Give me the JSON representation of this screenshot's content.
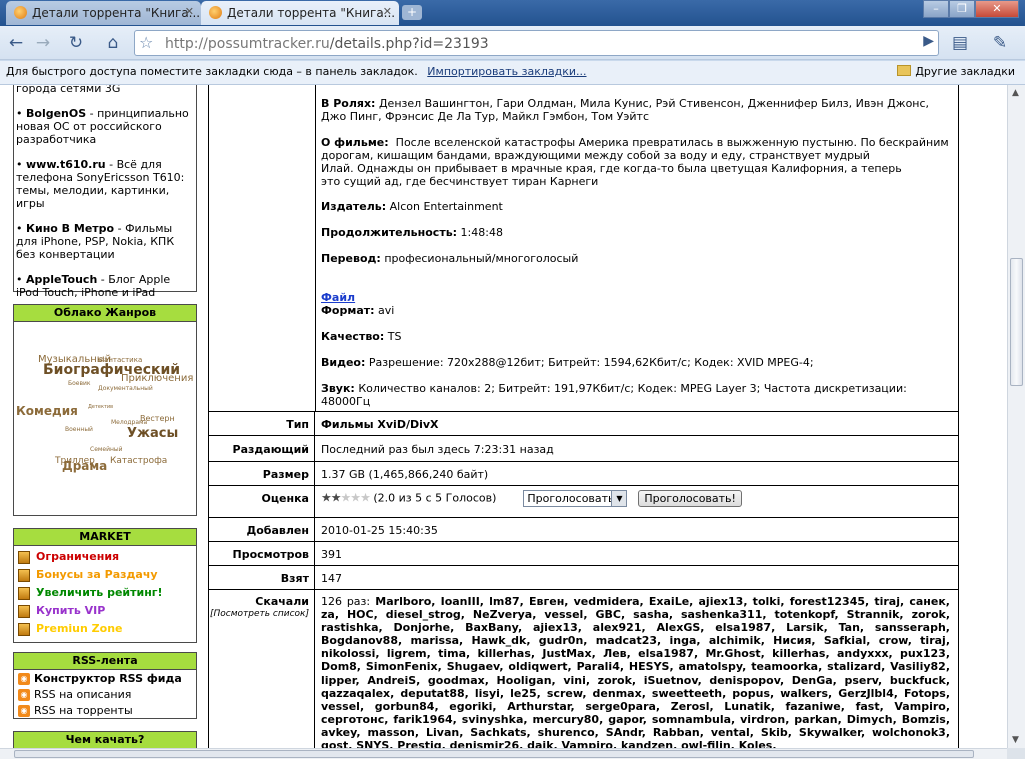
{
  "browser": {
    "tabs": [
      {
        "title": "Детали торрента \"Книга..."
      },
      {
        "title": "Детали торрента \"Книга..."
      }
    ],
    "url_host": "http://possumtracker.ru",
    "url_path": "/details.php?id=23193",
    "bookmarks_hint": "Для быстрого доступа поместите закладки сюда – в панель закладок.",
    "import_link": "Импортировать закладки...",
    "other_bookmarks": "Другие закладки"
  },
  "sidebar": {
    "sites": [
      {
        "pre": "города сетями 3G",
        "name": "",
        "desc": ""
      },
      {
        "name": "BolgenOS",
        "desc": " - принципиально новая ОС от российского разработчика"
      },
      {
        "name": "www.t610.ru",
        "desc": " - Всё для телефона SonyEricsson T610: темы, мелодии, картинки, игры"
      },
      {
        "name": "Кино В Метро",
        "desc": " - Фильмы для iPhone, PSP, Nokia, КПК без конвертации"
      },
      {
        "name": "AppleTouch",
        "desc": " - Блог Apple iPod Touch, iPhone и iPad"
      }
    ],
    "genre_cloud": {
      "title": "Облако Жанров",
      "tags": [
        "Музыкальный",
        "Фантастика",
        "Биографический",
        "Приключения",
        "Боевик",
        "Документальный",
        "Комедия",
        "Детектив",
        "Вестерн",
        "Мелодрама",
        "Военный",
        "Ужасы",
        "Семейный",
        "Триллер",
        "Драма",
        "Катастрофа"
      ]
    },
    "market": {
      "title": "MARKET",
      "items": [
        {
          "label": "Ограничения",
          "color": "#cc0000"
        },
        {
          "label": "Бонусы за Раздачу",
          "color": "#ff9900"
        },
        {
          "label": "Увеличить рейтинг!",
          "color": "#009900"
        },
        {
          "label": "Купить VIP",
          "color": "#9933cc"
        },
        {
          "label": "Premiun Zone",
          "color": "#ffcc00"
        }
      ]
    },
    "rss": {
      "title": "RSS-лента",
      "items": [
        "Конструктор RSS фида",
        "RSS на описания",
        "RSS на торренты"
      ]
    },
    "what_download": {
      "title": "Чем качать?"
    }
  },
  "details": {
    "cast_label": "В Ролях:",
    "cast": "Дензел Вашингтон, Гари Олдман, Мила Кунис, Рэй Стивенсон, Дженнифер Билз, Ивэн Джонс, Джо Пинг, Фрэнсис Де Ла Тур, Майкл Гэмбон, Том Уэйтс",
    "about_label": "О фильме:",
    "about_lines": [
      "После вселенской катастрофы Америка превратилась в выжженную пустыню. По бескрайним",
      "дорогам, кишащим бандами, враждующими между собой за воду и еду, странствует мудрый",
      "Илай. Однажды он прибывает в мрачные края, где когда-то была цветущая Калифорния, а теперь",
      "это сущий ад, где бесчинствует тиран Карнеги"
    ],
    "publisher_label": "Издатель:",
    "publisher": "Alcon Entertainment",
    "duration_label": "Продолжительность:",
    "duration": "1:48:48",
    "translation_label": "Перевод:",
    "translation": "професиональный/многоголосый",
    "file_link": "Файл",
    "format_label": "Формат:",
    "format": "avi",
    "quality_label": "Качество:",
    "quality": "TS",
    "video_label": "Видео:",
    "video": "Разрешение: 720x288@12бит; Битрейт: 1594,62Кбит/с; Кодек: XVID MPEG-4;",
    "audio_label": "Звук:",
    "audio": "Количество каналов: 2; Битрейт: 191,97Кбит/с; Кодек: MPEG Layer 3; Частота дискретизации: 48000Гц"
  },
  "info": {
    "type_label": "Тип",
    "type": "Фильмы XviD/DivX",
    "seeder_label": "Раздающий",
    "seeder": "Последний раз был здесь 7:23:31 назад",
    "size_label": "Размер",
    "size": "1.37 GB (1,465,866,240 байт)",
    "rating_label": "Оценка",
    "rating": 2,
    "rating_max": 5,
    "rating_text": "(2.0 из 5 с 5 Голосов)",
    "vote_select": "Проголосовать",
    "vote_button": "Проголосовать!",
    "added_label": "Добавлен",
    "added": "2010-01-25 15:40:35",
    "views_label": "Просмотров",
    "views": "391",
    "taken_label": "Взят",
    "taken": "147",
    "downloaded_label": "Скачали",
    "view_list": "[Посмотреть список]",
    "downloaded_count": "126 раз:",
    "downloaders": "Marlboro, IoanIII, lm87, Евген, vedmidera, ExaiLe, ajiex13, tolki, forest12345, tiraj, санек, za, HOC, diesel_strog, NeZverya, vessel, GBC, sasha, sashenka311, totenkopf, Strannik, zorok, rastishka, Donjorhe, BaxBany, ajiex13, alex921, AlexGS, elsa1987, Larsik, Tan, sansseraph, Bogdanov88, marissa, Hawk_dk, gudr0n, madcat23, inga, alchimik, Нисия, Safkial, crow, tiraj, nikolossi, ligrem, tima, killerhas, JustMax, Лев, elsa1987, Mr.Ghost, killerhas, andyxxx, pux123, Dom8, SimonFenix, Shugaev, oldiqwert, Parali4, HESYS, amatolspy, teamoorka, stalizard, Vasiliy82, lipper, AndreiS, goodmax, Hooligan, vini, zorok, iSuetnov, denispopov, DenGa, pserv, buckfuck, qazzaqalex, deputat88, lisyi, le25, screw, denmax, sweetteeth, popus, walkers, GerzJlbl4, Fotops, vessel, gorbun84, egoriki, Arthurstar, serge0para, Zerosl, Lunatik, fazaniwe, fast, Vampiro, серготонс, farik1964, svinyshka, mercury80, gapor, somnambula, virdron, parkan, Dimych, Bomzis, avkey, masson, Livan, Sachkats, shurenco, SAndr, Rabban, vental, Skib, Skywalker, wolchonok3, gost, SNYS, Prestig, denismir26, daik, Vampiro, kandzen, owl-filin, Koles,"
  }
}
